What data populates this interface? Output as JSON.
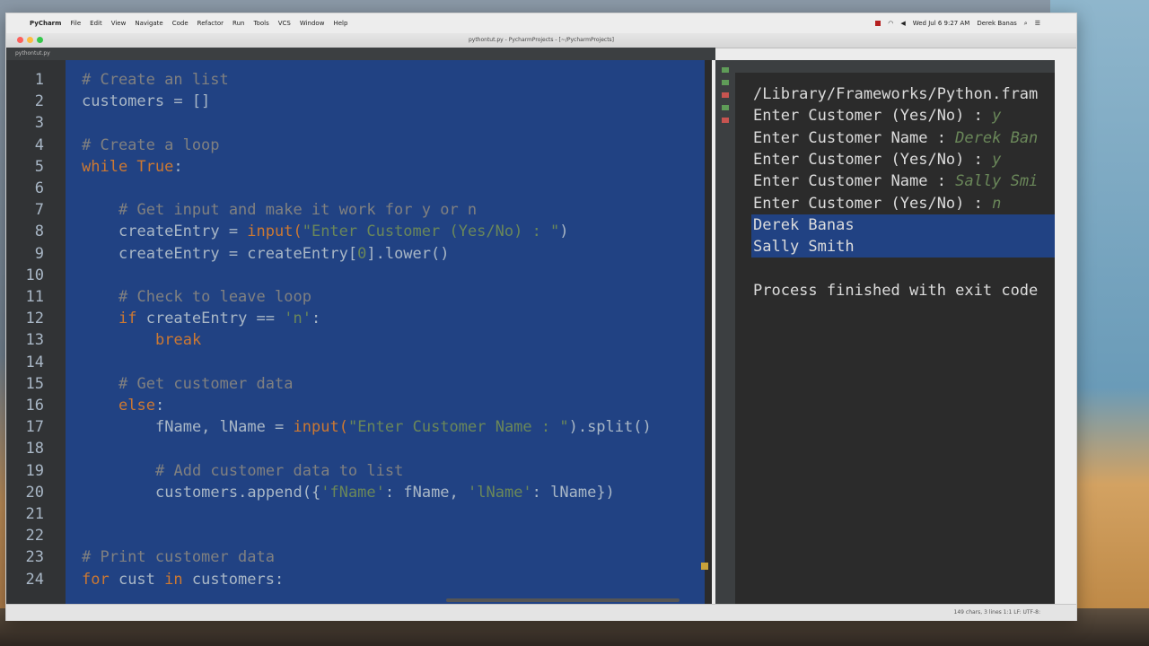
{
  "menubar": {
    "app_name": "PyCharm",
    "menus": [
      "File",
      "Edit",
      "View",
      "Navigate",
      "Code",
      "Refactor",
      "Run",
      "Tools",
      "VCS",
      "Window",
      "Help"
    ],
    "clock": "Wed Jul 6  9:27 AM",
    "user": "Derek Banas"
  },
  "window": {
    "title": "pythontut.py - PycharmProjects - [~/PycharmProjects]",
    "breadcrumbs": [
      "PycharmProjects",
      "pythontut.py"
    ],
    "tab": "pythontut.py",
    "status": "149 chars, 3 lines   1:1   LF:   UTF-8:"
  },
  "editor": {
    "lines": [
      {
        "n": "1",
        "indent": 0,
        "parts": [
          {
            "t": "# Create an list",
            "c": "cm"
          }
        ]
      },
      {
        "n": "2",
        "indent": 0,
        "parts": [
          {
            "t": "customers = []",
            "c": ""
          }
        ]
      },
      {
        "n": "3",
        "indent": 0,
        "parts": []
      },
      {
        "n": "4",
        "indent": 0,
        "parts": [
          {
            "t": "# Create a loop",
            "c": "cm"
          }
        ]
      },
      {
        "n": "5",
        "indent": 0,
        "parts": [
          {
            "t": "while ",
            "c": "kw"
          },
          {
            "t": "True",
            "c": "kw"
          },
          {
            "t": ":",
            "c": ""
          }
        ]
      },
      {
        "n": "6",
        "indent": 0,
        "parts": []
      },
      {
        "n": "7",
        "indent": 1,
        "parts": [
          {
            "t": "# Get input and make it work for y or n",
            "c": "cm"
          }
        ]
      },
      {
        "n": "8",
        "indent": 1,
        "parts": [
          {
            "t": "createEntry = ",
            "c": ""
          },
          {
            "t": "input(",
            "c": "kw"
          },
          {
            "t": "\"Enter Customer (Yes/No) : \"",
            "c": "st"
          },
          {
            "t": ")",
            "c": ""
          }
        ]
      },
      {
        "n": "9",
        "indent": 1,
        "parts": [
          {
            "t": "createEntry = createEntry[",
            "c": ""
          },
          {
            "t": "0",
            "c": "st"
          },
          {
            "t": "].lower()",
            "c": ""
          }
        ]
      },
      {
        "n": "10",
        "indent": 0,
        "parts": []
      },
      {
        "n": "11",
        "indent": 1,
        "parts": [
          {
            "t": "# Check to leave loop",
            "c": "cm"
          }
        ]
      },
      {
        "n": "12",
        "indent": 1,
        "parts": [
          {
            "t": "if ",
            "c": "kw"
          },
          {
            "t": "createEntry == ",
            "c": ""
          },
          {
            "t": "'n'",
            "c": "st"
          },
          {
            "t": ":",
            "c": ""
          }
        ]
      },
      {
        "n": "13",
        "indent": 2,
        "parts": [
          {
            "t": "break",
            "c": "kw"
          }
        ]
      },
      {
        "n": "14",
        "indent": 0,
        "parts": []
      },
      {
        "n": "15",
        "indent": 1,
        "parts": [
          {
            "t": "# Get customer data",
            "c": "cm"
          }
        ]
      },
      {
        "n": "16",
        "indent": 1,
        "parts": [
          {
            "t": "else",
            "c": "kw"
          },
          {
            "t": ":",
            "c": ""
          }
        ]
      },
      {
        "n": "17",
        "indent": 2,
        "parts": [
          {
            "t": "fName, lName = ",
            "c": ""
          },
          {
            "t": "input(",
            "c": "kw"
          },
          {
            "t": "\"Enter Customer Name : \"",
            "c": "st"
          },
          {
            "t": ").split()",
            "c": ""
          }
        ]
      },
      {
        "n": "18",
        "indent": 0,
        "parts": []
      },
      {
        "n": "19",
        "indent": 2,
        "parts": [
          {
            "t": "# Add customer data to list",
            "c": "cm"
          }
        ]
      },
      {
        "n": "20",
        "indent": 2,
        "parts": [
          {
            "t": "customers.append({",
            "c": ""
          },
          {
            "t": "'fName'",
            "c": "st"
          },
          {
            "t": ": fName, ",
            "c": ""
          },
          {
            "t": "'lName'",
            "c": "st"
          },
          {
            "t": ": lName})",
            "c": ""
          }
        ]
      },
      {
        "n": "21",
        "indent": 0,
        "parts": []
      },
      {
        "n": "22",
        "indent": 0,
        "parts": []
      },
      {
        "n": "23",
        "indent": 0,
        "parts": [
          {
            "t": "# Print customer data",
            "c": "cm"
          }
        ]
      },
      {
        "n": "24",
        "indent": 0,
        "parts": [
          {
            "t": "for ",
            "c": "kw"
          },
          {
            "t": "cust ",
            "c": ""
          },
          {
            "t": "in ",
            "c": "kw"
          },
          {
            "t": "customers:",
            "c": ""
          }
        ]
      }
    ]
  },
  "console": {
    "lines": [
      {
        "t": "/Library/Frameworks/Python.fram",
        "inp": "",
        "selected": false
      },
      {
        "t": "Enter Customer (Yes/No) : ",
        "inp": "y",
        "selected": false
      },
      {
        "t": "Enter Customer Name : ",
        "inp": "Derek Ban",
        "selected": false
      },
      {
        "t": "Enter Customer (Yes/No) : ",
        "inp": "y",
        "selected": false
      },
      {
        "t": "Enter Customer Name : ",
        "inp": "Sally Smi",
        "selected": false
      },
      {
        "t": "Enter Customer (Yes/No) : ",
        "inp": "n",
        "selected": false
      },
      {
        "t": "Derek Banas",
        "inp": "",
        "selected": true
      },
      {
        "t": "Sally Smith",
        "inp": "",
        "selected": true
      },
      {
        "t": "",
        "inp": "",
        "selected": false
      },
      {
        "t": "Process finished with exit code",
        "inp": "",
        "selected": false
      }
    ]
  },
  "colors": {
    "selection": "#214283",
    "keyword": "#cc7832",
    "comment": "#808080",
    "string": "#6a8759"
  }
}
